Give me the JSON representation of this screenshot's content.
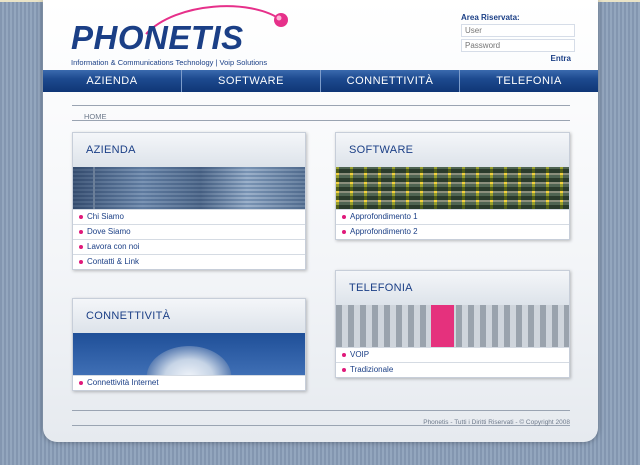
{
  "brand": {
    "name": "PHONETIS",
    "tagline": "Information & Communications Technology | Voip Solutions"
  },
  "login": {
    "title": "Area Riservata:",
    "user_placeholder": "User",
    "password_placeholder": "Password",
    "submit_label": "Entra"
  },
  "nav": [
    "AZIENDA",
    "SOFTWARE",
    "CONNETTIVITÀ",
    "TELEFONIA"
  ],
  "breadcrumb": "HOME",
  "boxes": {
    "azienda": {
      "title": "AZIENDA",
      "items": [
        "Chi Siamo",
        "Dove Siamo",
        "Lavora con noi",
        "Contatti & Link"
      ]
    },
    "software": {
      "title": "SOFTWARE",
      "items": [
        "Approfondimento 1",
        "Approfondimento 2"
      ]
    },
    "connettivita": {
      "title": "CONNETTIVITÀ",
      "items": [
        "Connettività Internet"
      ]
    },
    "telefonia": {
      "title": "TELEFONIA",
      "items": [
        "VOIP",
        "Tradizionale"
      ]
    }
  },
  "footer": "Phonetis - Tutti i Diritti Riservati - © Copyright 2008",
  "colors": {
    "brand_blue": "#1b3f86",
    "nav_blue": "#1d4a8f",
    "bullet_pink": "#e0197a"
  }
}
